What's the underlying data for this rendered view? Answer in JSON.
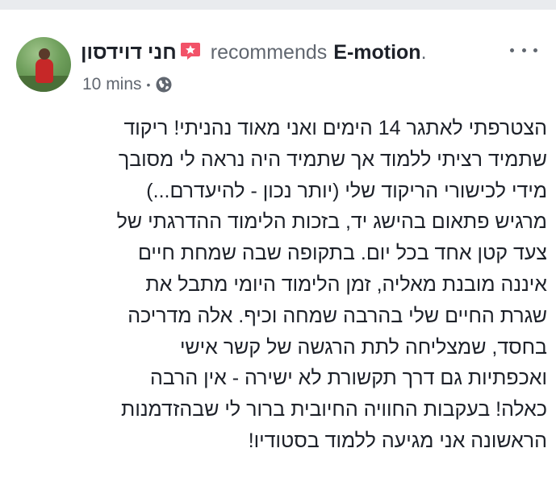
{
  "post": {
    "author": "חני דוידסון",
    "verb": "recommends",
    "page": "E-motion",
    "period": ".",
    "time": "10 mins",
    "separator": "•",
    "privacy_icon": "globe-icon",
    "badge_icon": "star-badge-icon",
    "more_icon": "more-options-icon",
    "body_lines": [
      "הצטרפתי לאתגר 14 הימים ואני מאוד נהניתי! ריקוד",
      "שתמיד רציתי ללמוד אך שתמיד היה נראה לי מסובך",
      "מידי לכישורי הריקוד שלי (יותר נכון - להיעדרם...)",
      "מרגיש פתאום בהישג יד, בזכות הלימוד ההדרגתי של",
      "צעד קטן אחד בכל יום. בתקופה שבה שמחת חיים",
      "איננה מובנת מאליה, זמן הלימוד היומי מתבל את",
      "שגרת החיים שלי בהרבה שמחה וכיף. אלה מדריכה",
      "בחסד, שמצליחה לתת הרגשה של קשר אישי",
      "ואכפתיות גם דרך תקשורת לא ישירה - אין הרבה",
      "כאלה! בעקבות החוויה החיובית ברור לי שבהזדמנות",
      "הראשונה אני מגיעה ללמוד בסטודיו!"
    ]
  },
  "colors": {
    "text": "#1d2129",
    "secondary": "#616770",
    "badge": "#f25268",
    "background": "#e9ebee",
    "card": "#ffffff"
  }
}
